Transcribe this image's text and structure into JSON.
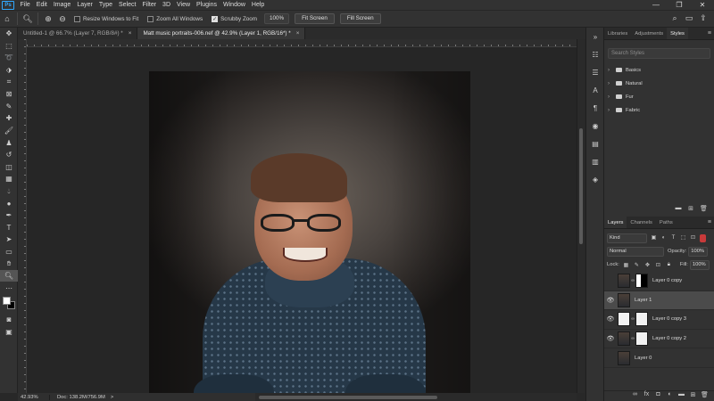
{
  "menubar": {
    "logo": "Ps",
    "items": [
      "File",
      "Edit",
      "Image",
      "Layer",
      "Type",
      "Select",
      "Filter",
      "3D",
      "View",
      "Plugins",
      "Window",
      "Help"
    ],
    "window_controls": [
      "—",
      "❐",
      "✕"
    ]
  },
  "options": {
    "resize_windows_label": "Resize Windows to Fit",
    "resize_windows_checked": false,
    "zoom_all_label": "Zoom All Windows",
    "zoom_all_checked": false,
    "scrubby_zoom_label": "Scrubby Zoom",
    "scrubby_zoom_checked": true,
    "zoom_value": "100%",
    "fit_screen_label": "Fit Screen",
    "fill_screen_label": "Fill Screen"
  },
  "tabs": [
    {
      "label": "Untitled-1 @ 66.7% (Layer 7, RGB/8#) *",
      "active": false
    },
    {
      "label": "Matt music portraits-006.nef @ 42.9% (Layer 1, RGB/16*) *",
      "active": true
    }
  ],
  "statusbar": {
    "zoom": "42.93%",
    "doc": "Doc: 138.2M/756.9M",
    "arrow": ">"
  },
  "styles_panel": {
    "tabs": [
      "Libraries",
      "Adjustments",
      "Styles"
    ],
    "active_tab": "Styles",
    "search_placeholder": "Search Styles",
    "folders": [
      "Basics",
      "Natural",
      "Fur",
      "Fabric"
    ]
  },
  "layers_panel": {
    "tabs": [
      "Layers",
      "Channels",
      "Paths"
    ],
    "active_tab": "Layers",
    "kind_label": "Kind",
    "blend_mode": "Normal",
    "opacity_label": "Opacity:",
    "opacity_value": "100%",
    "lock_label": "Lock:",
    "fill_label": "Fill:",
    "fill_value": "100%",
    "layers": [
      {
        "name": "Layer 0 copy",
        "visible": false,
        "selected": false
      },
      {
        "name": "Layer 1",
        "visible": true,
        "selected": true
      },
      {
        "name": "Layer 0 copy 3",
        "visible": true,
        "selected": false
      },
      {
        "name": "Layer 0 copy 2",
        "visible": true,
        "selected": false
      },
      {
        "name": "Layer 0",
        "visible": false,
        "selected": false
      }
    ]
  },
  "colors": {
    "foreground": "#ffffff",
    "background": "#000000",
    "accent": "#31a8ff"
  }
}
